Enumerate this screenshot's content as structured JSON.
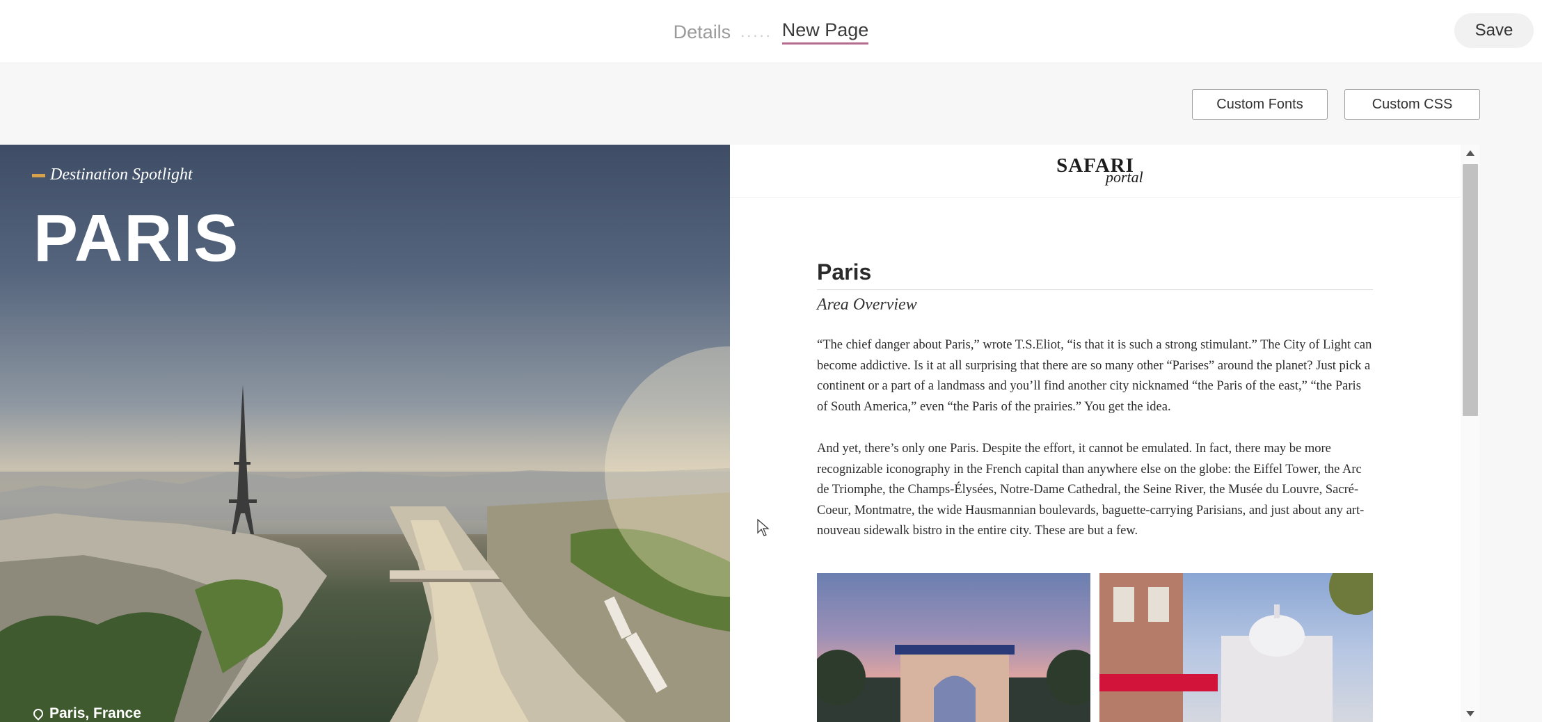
{
  "header": {
    "steps": [
      "Details",
      "New Page"
    ],
    "step_dots": ".....",
    "save_label": "Save"
  },
  "toolbar": {
    "custom_fonts_label": "Custom Fonts",
    "custom_css_label": "Custom CSS"
  },
  "hero": {
    "eyebrow": "Destination Spotlight",
    "title": "PARIS",
    "location": "Paris, France"
  },
  "document": {
    "logo_main": "SAFARI",
    "logo_sub": "portal",
    "title": "Paris",
    "subtitle": "Area Overview",
    "paragraphs": [
      "“The chief danger about Paris,” wrote T.S.Eliot, “is that it is such a strong stimulant.” The City of Light can become addictive. Is it at all surprising that there are so many other “Parises” around the planet? Just pick a continent or a part of a landmass and you’ll find another city nicknamed “the Paris of the east,” “the Paris of South America,” even “the Paris of the prairies.” You get the idea.",
      "And yet, there’s only one Paris. Despite the effort, it cannot be emulated. In fact, there may be more recognizable iconography in the French capital than anywhere else on the globe: the Eiffel Tower, the Arc de Triomphe, the Champs-Élysées, Notre-Dame Cathedral, the Seine River, the Musée du Louvre, Sacré-Coeur, Montmatre, the wide Hausmannian boulevards, baguette-carrying Parisians, and just about any art-nouveau sidewalk bistro in the entire city. These are but a few."
    ]
  },
  "colors": {
    "accent_underline": "#b56a8e",
    "eyebrow_bar": "#d8a24c"
  }
}
